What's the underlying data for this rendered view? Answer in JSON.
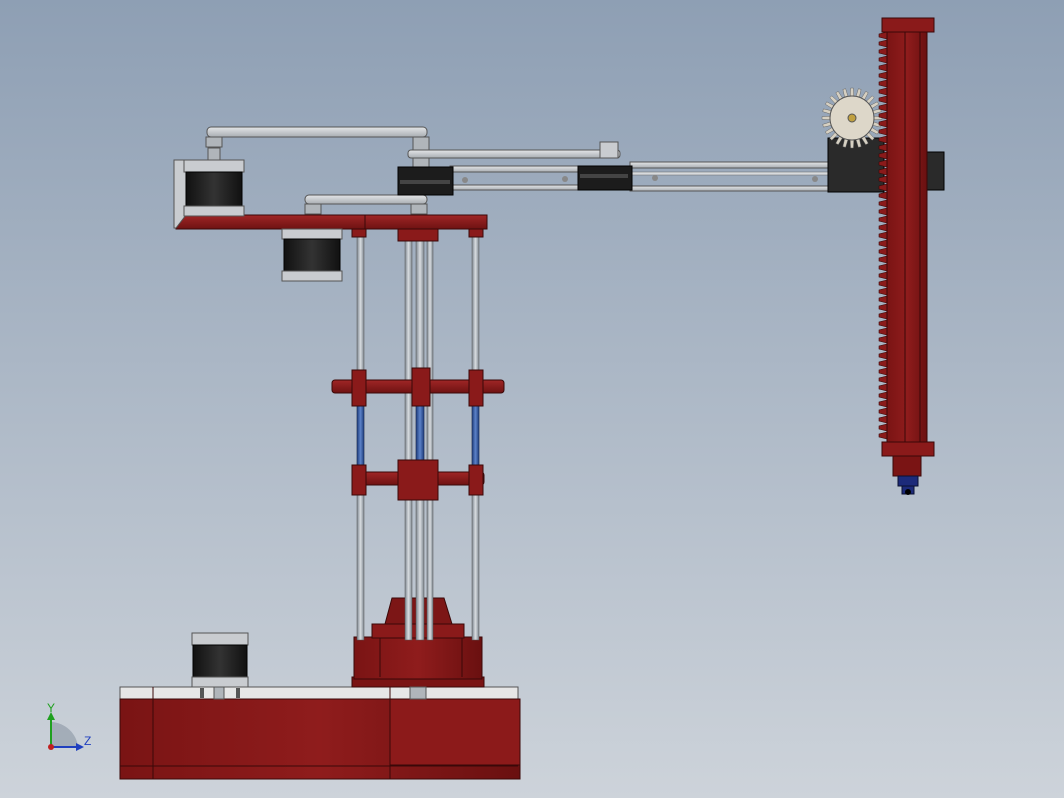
{
  "view": {
    "background_top": "#8e9fb4",
    "background_bottom": "#cdd3da"
  },
  "model": {
    "part_color": "#8a1a1a",
    "part_dark": "#5e0f0f",
    "motor_color": "#1b1b1b",
    "rod_color": "#9aa4ad",
    "link_color": "#c9ccd0",
    "gear_color": "#d6d0c2"
  },
  "triad": {
    "y_label": "Y",
    "z_label": "Z",
    "y_color": "#1fa01f",
    "z_color": "#1f3fbf",
    "x_color": "#c01f1f"
  }
}
